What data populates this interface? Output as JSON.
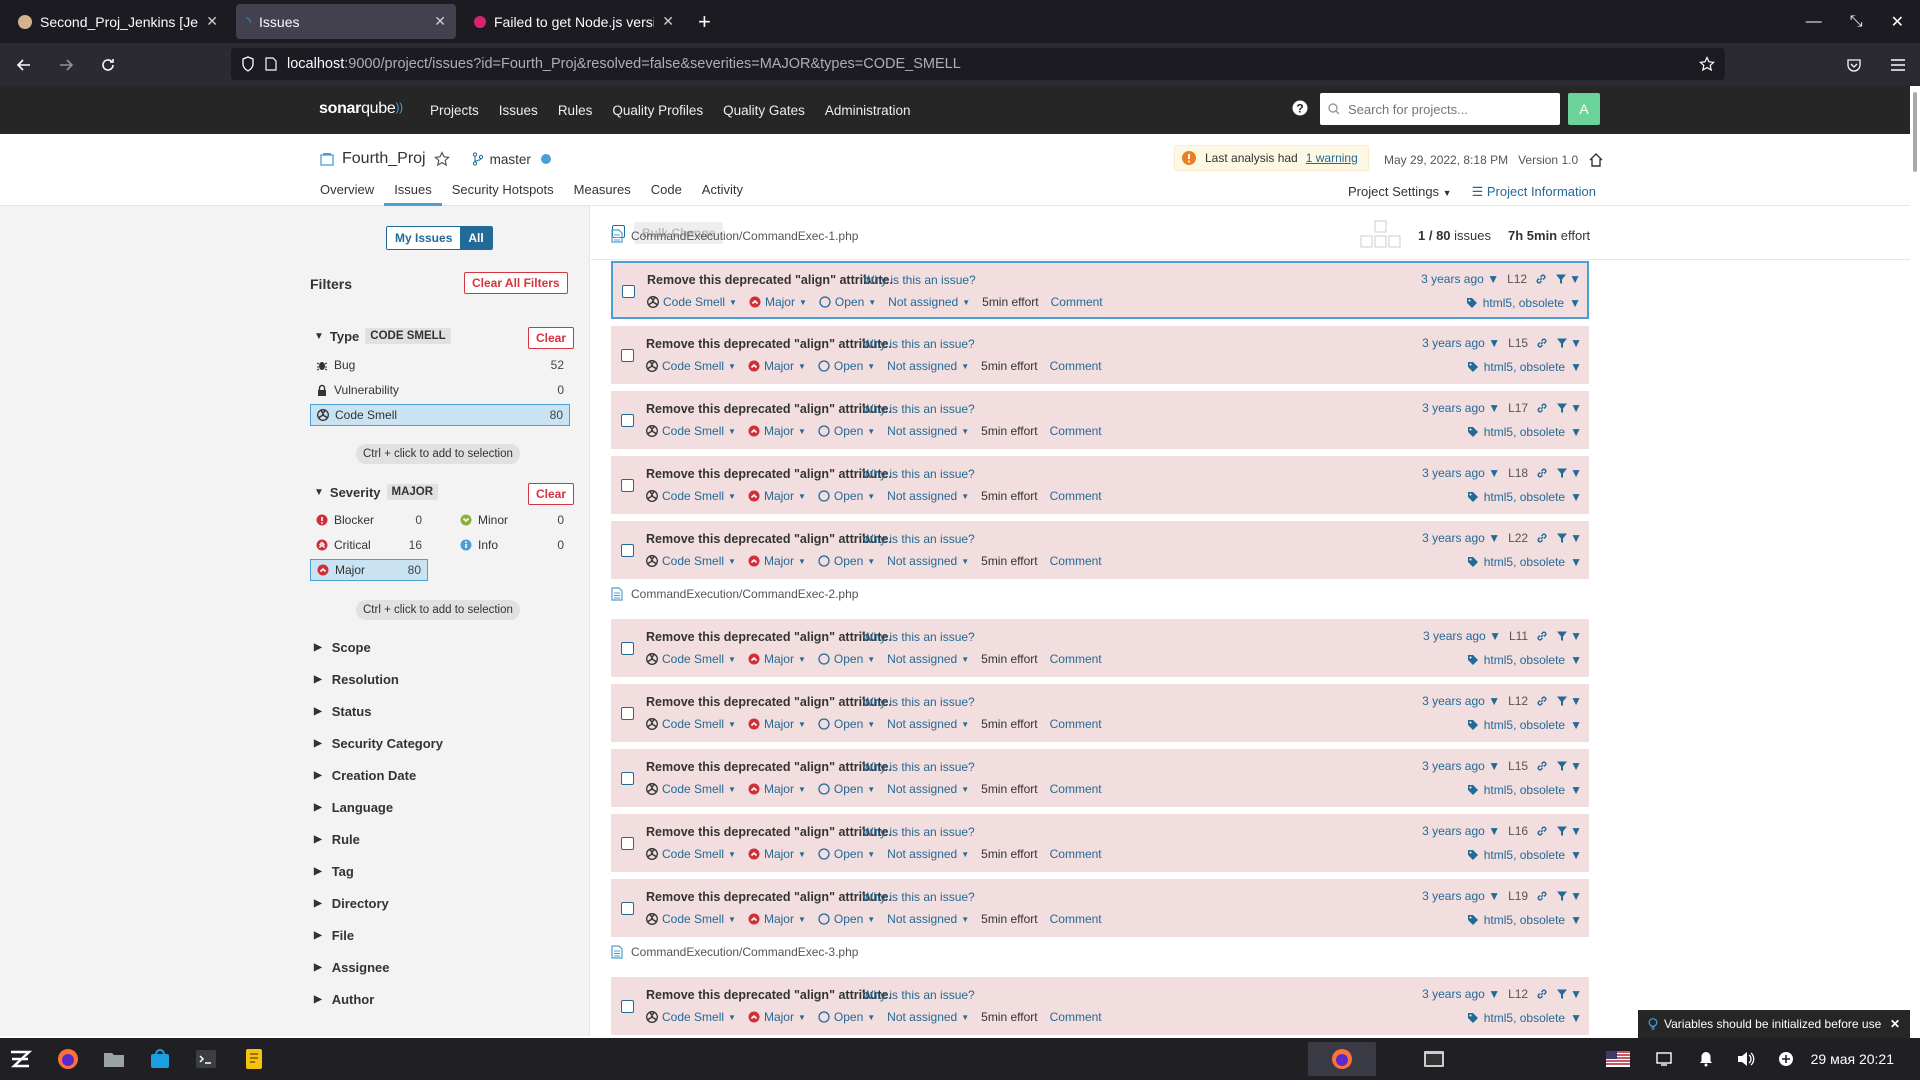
{
  "browser": {
    "tabs": [
      {
        "title": "Second_Proj_Jenkins [Jenkins]",
        "active": false
      },
      {
        "title": "Issues",
        "active": true
      },
      {
        "title": "Failed to get Node.js version",
        "active": false
      }
    ],
    "url_host": "localhost",
    "url_path": ":9000/project/issues?id=Fourth_Proj&resolved=false&severities=MAJOR&types=CODE_SMELL"
  },
  "header": {
    "logo_main": "sonar",
    "logo_sub": "qube",
    "nav": [
      "Projects",
      "Issues",
      "Rules",
      "Quality Profiles",
      "Quality Gates",
      "Administration"
    ],
    "search_placeholder": "Search for projects...",
    "avatar_letter": "A"
  },
  "project": {
    "name": "Fourth_Proj",
    "branch": "master",
    "warning_prefix": "Last analysis had",
    "warning_link": "1 warning",
    "analysis_date": "May 29, 2022, 8:18 PM",
    "version": "Version 1.0",
    "tabs": [
      "Overview",
      "Issues",
      "Security Hotspots",
      "Measures",
      "Code",
      "Activity"
    ],
    "settings_label": "Project Settings",
    "info_label": "Project Information"
  },
  "sidebar": {
    "my_issues": "My Issues",
    "all": "All",
    "filters_title": "Filters",
    "clear_all": "Clear All Filters",
    "clear": "Clear",
    "type_title": "Type",
    "type_tag": "CODE SMELL",
    "types": [
      {
        "label": "Bug",
        "count": "52"
      },
      {
        "label": "Vulnerability",
        "count": "0"
      },
      {
        "label": "Code Smell",
        "count": "80"
      }
    ],
    "hint": "Ctrl + click to add to selection",
    "severity_title": "Severity",
    "severity_tag": "MAJOR",
    "severities": [
      {
        "label": "Blocker",
        "count": "0"
      },
      {
        "label": "Minor",
        "count": "0"
      },
      {
        "label": "Critical",
        "count": "16"
      },
      {
        "label": "Info",
        "count": "0"
      },
      {
        "label": "Major",
        "count": "80"
      }
    ],
    "collapsed": [
      "Scope",
      "Resolution",
      "Status",
      "Security Category",
      "Creation Date",
      "Language",
      "Rule",
      "Tag",
      "Directory",
      "File",
      "Assignee",
      "Author"
    ]
  },
  "toolbar": {
    "bulk_change": "Bulk Change",
    "issue_count": "1 / 80",
    "issues_word": "issues",
    "effort_value": "7h 5min",
    "effort_word": "effort"
  },
  "issue_common": {
    "message": "Remove this deprecated \"align\" attribute.",
    "why": "Why is this an issue?",
    "type": "Code Smell",
    "severity": "Major",
    "status": "Open",
    "assignee": "Not assigned",
    "effort": "5min effort",
    "comment": "Comment",
    "age": "3 years ago",
    "tags": "html5, obsolete"
  },
  "files": [
    {
      "name": "CommandExecution/CommandExec-1.php",
      "lines": [
        "L12",
        "L15",
        "L17",
        "L18",
        "L22"
      ]
    },
    {
      "name": "CommandExecution/CommandExec-2.php",
      "lines": [
        "L11",
        "L12",
        "L15",
        "L16",
        "L19"
      ]
    },
    {
      "name": "CommandExecution/CommandExec-3.php",
      "lines": [
        "L12"
      ]
    }
  ],
  "notification": "Variables should be initialized before use",
  "taskbar": {
    "clock": "29 мая 20:21"
  }
}
